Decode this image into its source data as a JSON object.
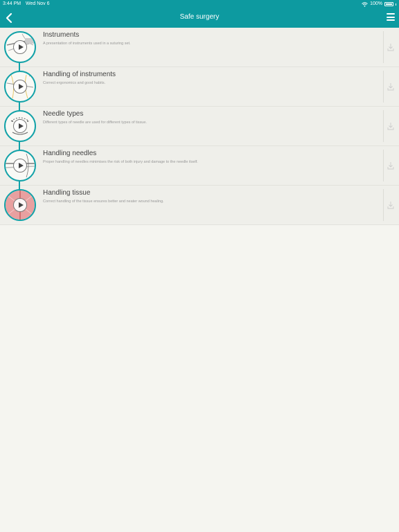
{
  "status": {
    "time": "3:44 PM",
    "date": "Wed Nov 6",
    "battery": "100%"
  },
  "header": {
    "title": "Safe surgery"
  },
  "items": [
    {
      "title": "Instruments",
      "desc": "A presentation of instruments used in a suturing set."
    },
    {
      "title": "Handling of instruments",
      "desc": "Correct ergonomics and good habits."
    },
    {
      "title": "Needle types",
      "desc": "Different types of needle are used for different types of tissue."
    },
    {
      "title": "Handling needles",
      "desc": "Proper handling of needles minimises the risk of both injury and damage to the needle itself."
    },
    {
      "title": "Handling tissue",
      "desc": "Correct handling of the tissue ensures better and neater wound healing."
    }
  ],
  "colors": {
    "accent": "#0d9aa0",
    "background": "#f5f5f0"
  }
}
